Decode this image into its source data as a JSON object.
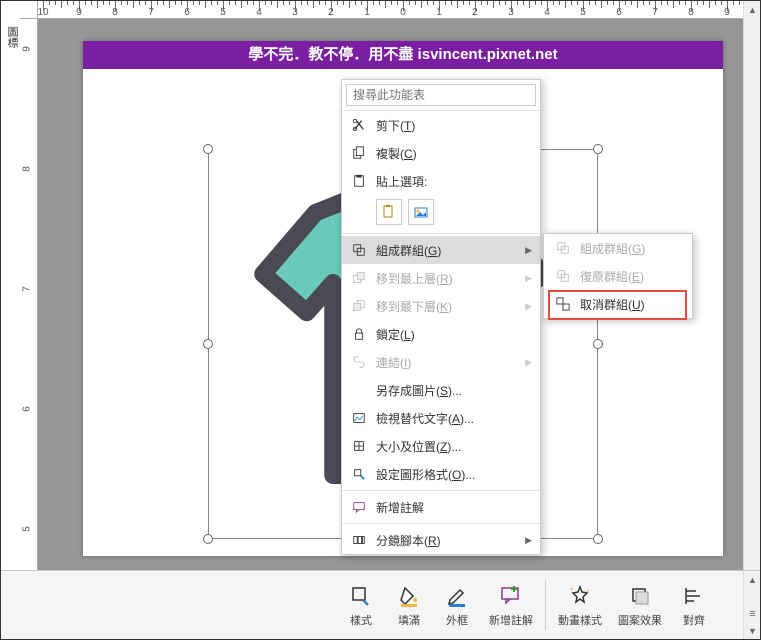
{
  "vertical_label": "圖標",
  "banner": "學不完．教不停．用不盡 isvincent.pixnet.net",
  "ruler_h_nums": [
    "10",
    "9",
    "8",
    "7",
    "6",
    "5",
    "4",
    "3",
    "2",
    "1",
    "0",
    "1",
    "2",
    "3",
    "4",
    "5",
    "6",
    "7",
    "8",
    "9"
  ],
  "ruler_v_nums": [
    "9",
    "8",
    "7",
    "6",
    "5"
  ],
  "search": {
    "placeholder": "搜尋此功能表"
  },
  "menu": {
    "cut": "剪下(T)",
    "copy": "複製(C)",
    "paste_label": "貼上選項:",
    "group": "組成群組(G)",
    "bring_front": "移到最上層(R)",
    "send_back": "移到最下層(K)",
    "lock": "鎖定(L)",
    "link": "連結(I)",
    "save_pic": "另存成圖片(S)...",
    "alt_text": "檢視替代文字(A)...",
    "size_pos": "大小及位置(Z)...",
    "format_shape": "設定圖形格式(O)...",
    "new_comment": "新增註解",
    "storyboard": "分鏡腳本(R)"
  },
  "submenu": {
    "group": "組成群組(G)",
    "regroup": "復原群組(E)",
    "ungroup": "取消群組(U)"
  },
  "toolbar": {
    "style": "樣式",
    "fill": "填滿",
    "outline": "外框",
    "comment": "新增註解",
    "anim": "動畫樣式",
    "effect": "圖案效果",
    "align": "對齊"
  }
}
